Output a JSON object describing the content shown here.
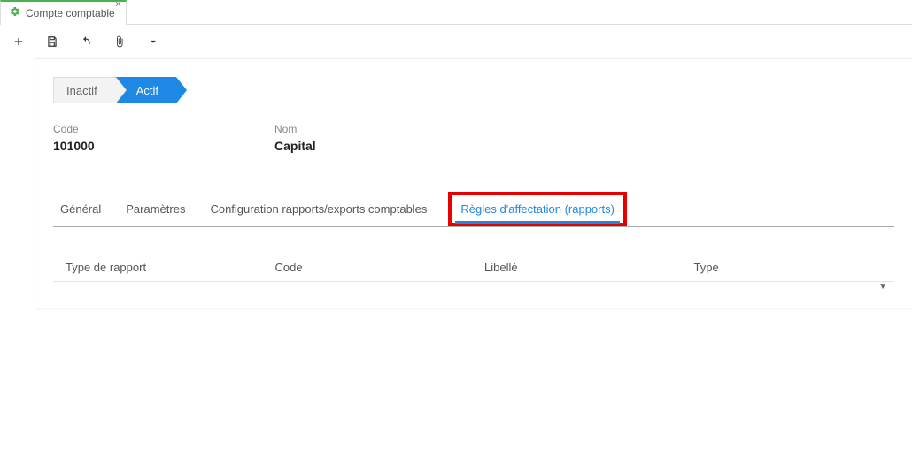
{
  "window": {
    "tab_title": "Compte comptable"
  },
  "status": {
    "inactif": "Inactif",
    "actif": "Actif"
  },
  "fields": {
    "code_label": "Code",
    "code_value": "101000",
    "nom_label": "Nom",
    "nom_value": "Capital"
  },
  "subtabs": {
    "general": "Général",
    "parametres": "Paramètres",
    "config": "Configuration rapports/exports comptables",
    "regles": "Règles d'affectation (rapports)"
  },
  "table": {
    "col1": "Type de rapport",
    "col2": "Code",
    "col3": "Libellé",
    "col4": "Type"
  }
}
